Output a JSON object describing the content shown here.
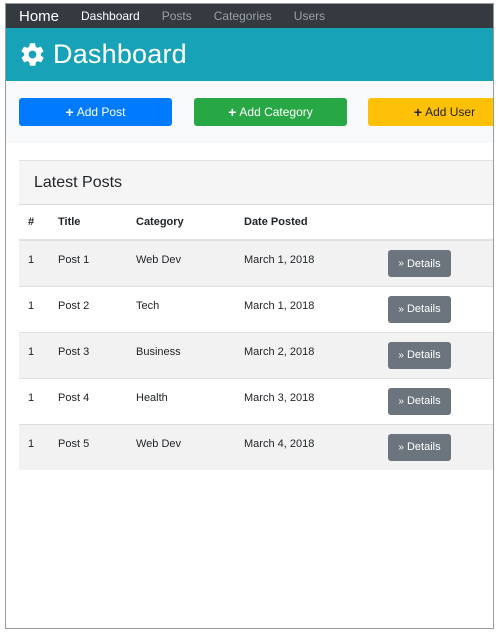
{
  "navbar": {
    "brand": "Home",
    "links": [
      "Dashboard",
      "Posts",
      "Categories",
      "Users"
    ]
  },
  "header": {
    "title": "Dashboard",
    "icon": "gear-icon"
  },
  "actions": {
    "add_post": "Add Post",
    "add_category": "Add Category",
    "add_user": "Add User",
    "icon": "plus-icon"
  },
  "latest_posts": {
    "title": "Latest Posts",
    "columns": [
      "#",
      "Title",
      "Category",
      "Date Posted"
    ],
    "rows": [
      {
        "num": "1",
        "title": "Post 1",
        "category": "Web Dev",
        "date": "March 1, 2018",
        "action": "Details"
      },
      {
        "num": "1",
        "title": "Post 2",
        "category": "Tech",
        "date": "March 1, 2018",
        "action": "Details"
      },
      {
        "num": "1",
        "title": "Post 3",
        "category": "Business",
        "date": "March 2, 2018",
        "action": "Details"
      },
      {
        "num": "1",
        "title": "Post 4",
        "category": "Health",
        "date": "March 3, 2018",
        "action": "Details"
      },
      {
        "num": "1",
        "title": "Post 5",
        "category": "Web Dev",
        "date": "March 4, 2018",
        "action": "Details"
      }
    ]
  },
  "colors": {
    "navbar": "#343a40",
    "header": "#17a2b8",
    "primary": "#007bff",
    "success": "#28a745",
    "warning": "#ffc107",
    "secondary": "#6c757d"
  }
}
